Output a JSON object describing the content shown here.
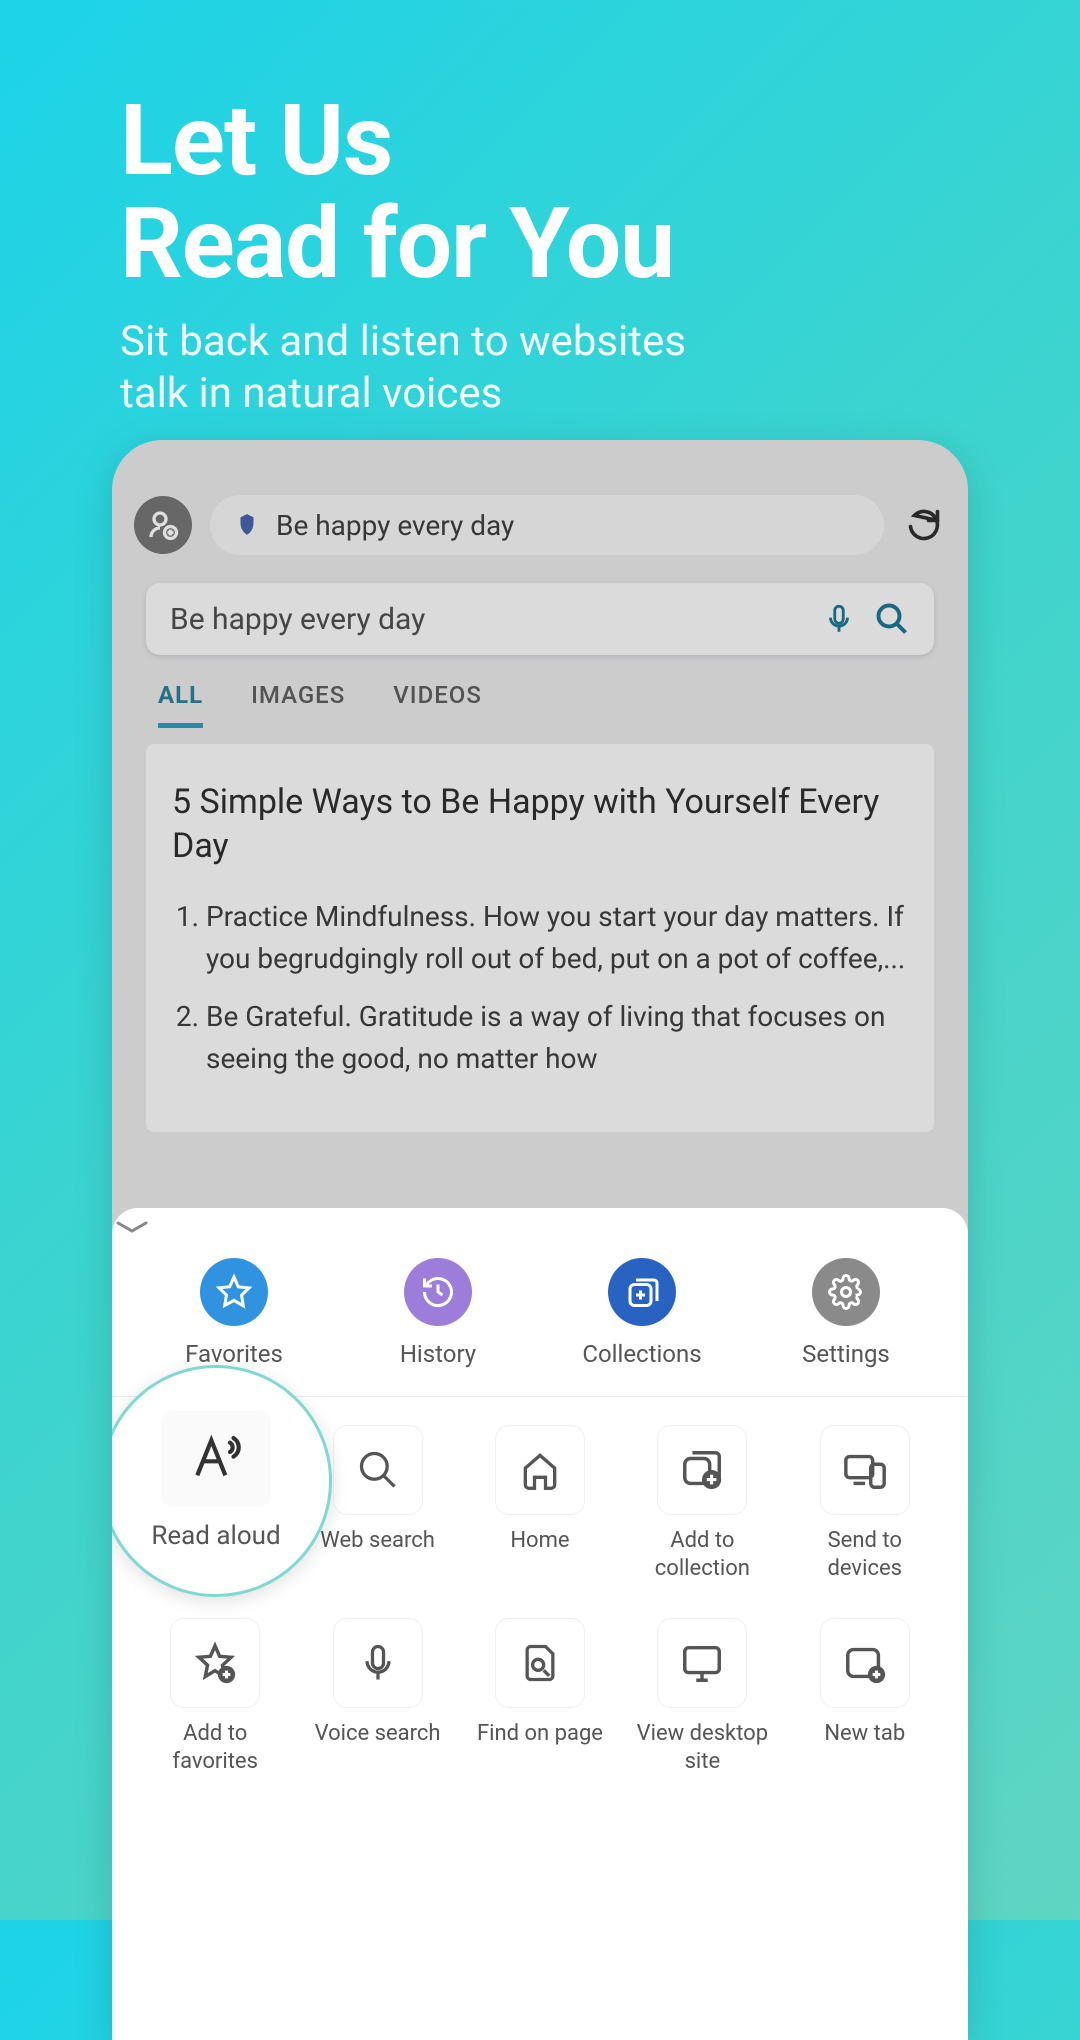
{
  "hero": {
    "title_line1": "Let Us",
    "title_line2": "Read for You",
    "subtitle_line1": "Sit back and listen to websites",
    "subtitle_line2": "talk in natural voices"
  },
  "address_bar": {
    "text": "Be happy every day"
  },
  "search_field": {
    "text": "Be happy every day"
  },
  "tabs": {
    "all": "ALL",
    "images": "IMAGES",
    "videos": "VIDEOS"
  },
  "result": {
    "title": "5 Simple Ways to Be Happy with Yourself Every Day",
    "item1": "Practice Mindfulness. How you start your day matters. If you begrudgingly roll out of bed, put on a pot of coffee,...",
    "item2": "Be Grateful. Gratitude is a way of living that focuses on seeing the good, no matter how"
  },
  "primary": {
    "favorites": "Favorites",
    "history": "History",
    "collections": "Collections",
    "settings": "Settings"
  },
  "read_aloud": {
    "label": "Read aloud"
  },
  "grid1": {
    "web_search": "Web search",
    "home": "Home",
    "add_to_collection": "Add to collection",
    "send_to_devices": "Send to devices"
  },
  "grid2": {
    "add_to_favorites": "Add to favorites",
    "voice_search": "Voice search",
    "find_on_page": "Find on page",
    "view_desktop_site": "View desktop site",
    "new_tab": "New tab"
  },
  "colors": {
    "favorites": "#2f93e0",
    "history": "#9c7dd9",
    "collections": "#2863c2",
    "settings": "#8a8a8a"
  }
}
